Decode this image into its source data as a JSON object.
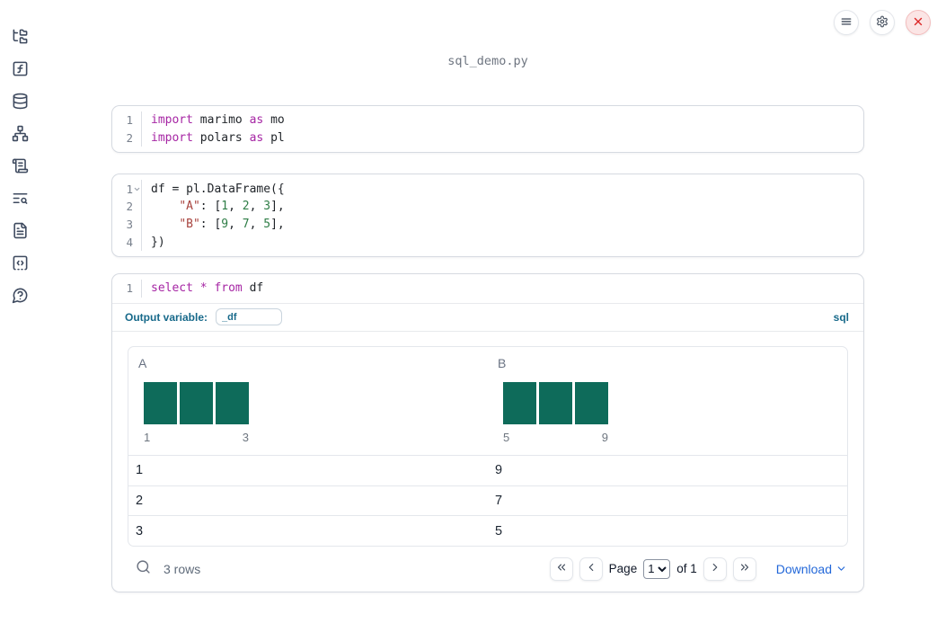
{
  "window": {
    "filename": "sql_demo.py"
  },
  "sidebar": {
    "items": [
      {
        "icon": "folder-tree-icon",
        "name": "file-explorer"
      },
      {
        "icon": "function-square-icon",
        "name": "functions"
      },
      {
        "icon": "database-icon",
        "name": "datasources"
      },
      {
        "icon": "network-icon",
        "name": "dependency-graph"
      },
      {
        "icon": "scroll-text-icon",
        "name": "logs"
      },
      {
        "icon": "text-search-icon",
        "name": "search-logs"
      },
      {
        "icon": "file-text-icon",
        "name": "documentation"
      },
      {
        "icon": "code-snippet-icon",
        "name": "snippets"
      },
      {
        "icon": "help-circle-icon",
        "name": "help"
      }
    ]
  },
  "topbar": {
    "menu_button": "menu",
    "settings_button": "settings",
    "close_button": "close"
  },
  "cells": [
    {
      "name": "imports-cell",
      "lines": [
        {
          "num": "1",
          "tokens": [
            {
              "t": "import",
              "c": "kw"
            },
            {
              "t": " marimo ",
              "c": ""
            },
            {
              "t": "as",
              "c": "kw"
            },
            {
              "t": " mo",
              "c": ""
            }
          ]
        },
        {
          "num": "2",
          "tokens": [
            {
              "t": "import",
              "c": "kw"
            },
            {
              "t": " polars ",
              "c": ""
            },
            {
              "t": "as",
              "c": "kw"
            },
            {
              "t": " pl",
              "c": ""
            }
          ]
        }
      ]
    },
    {
      "name": "dataframe-cell",
      "lines": [
        {
          "num": "1",
          "fold": true,
          "tokens": [
            {
              "t": "df = pl.DataFrame({",
              "c": ""
            }
          ]
        },
        {
          "num": "2",
          "tokens": [
            {
              "t": "    ",
              "c": ""
            },
            {
              "t": "\"A\"",
              "c": "str"
            },
            {
              "t": ": [",
              "c": ""
            },
            {
              "t": "1",
              "c": "num"
            },
            {
              "t": ", ",
              "c": ""
            },
            {
              "t": "2",
              "c": "num"
            },
            {
              "t": ", ",
              "c": ""
            },
            {
              "t": "3",
              "c": "num"
            },
            {
              "t": "],",
              "c": ""
            }
          ]
        },
        {
          "num": "3",
          "tokens": [
            {
              "t": "    ",
              "c": ""
            },
            {
              "t": "\"B\"",
              "c": "str"
            },
            {
              "t": ": [",
              "c": ""
            },
            {
              "t": "9",
              "c": "num"
            },
            {
              "t": ", ",
              "c": ""
            },
            {
              "t": "7",
              "c": "num"
            },
            {
              "t": ", ",
              "c": ""
            },
            {
              "t": "5",
              "c": "num"
            },
            {
              "t": "],",
              "c": ""
            }
          ]
        },
        {
          "num": "4",
          "tokens": [
            {
              "t": "})",
              "c": ""
            }
          ]
        }
      ]
    },
    {
      "name": "sql-cell",
      "lines": [
        {
          "num": "1",
          "tokens": [
            {
              "t": "select",
              "c": "kw"
            },
            {
              "t": " ",
              "c": ""
            },
            {
              "t": "*",
              "c": "kw"
            },
            {
              "t": " ",
              "c": ""
            },
            {
              "t": "from",
              "c": "kw"
            },
            {
              "t": " df",
              "c": ""
            }
          ]
        }
      ],
      "footer": {
        "label": "Output variable:",
        "variable": "_df",
        "language": "sql"
      }
    }
  ],
  "output_table": {
    "columns": [
      {
        "label": "A",
        "hist": {
          "type": "bar",
          "bars": [
            1,
            1,
            1
          ],
          "tick_left": "1",
          "tick_right": "3"
        }
      },
      {
        "label": "B",
        "hist": {
          "type": "bar",
          "bars": [
            1,
            1,
            1
          ],
          "tick_left": "5",
          "tick_right": "9"
        }
      }
    ],
    "rows": [
      [
        "1",
        "9"
      ],
      [
        "2",
        "7"
      ],
      [
        "3",
        "5"
      ]
    ],
    "footer": {
      "row_count": "3 rows",
      "page_label": "Page",
      "page_value": "1",
      "of_label": "of 1",
      "download_label": "Download"
    }
  },
  "colors": {
    "accent_blue": "#17698a",
    "bar_teal": "#0e6b5a",
    "download_blue": "#2368d9",
    "close_red": "#dc2626",
    "keyword_purple": "#a626a4",
    "string_red": "#a8443f",
    "number_green": "#2e7d46"
  }
}
